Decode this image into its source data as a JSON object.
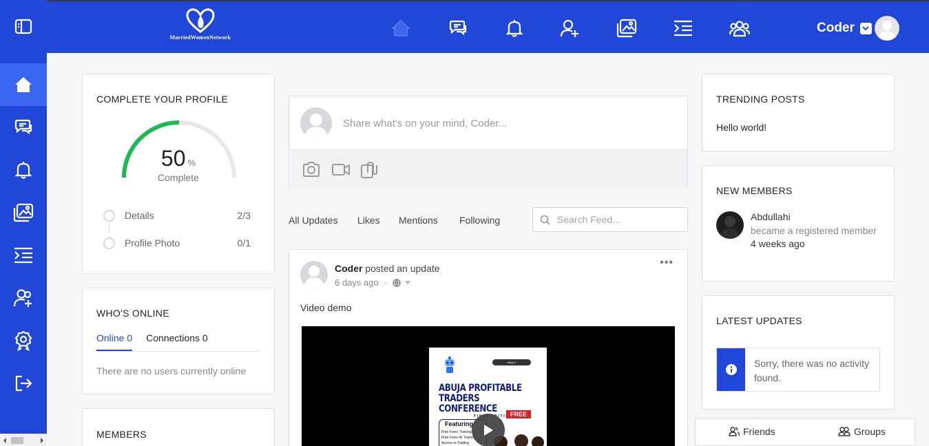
{
  "brand": {
    "logo_text": "MarriedWomenNetwork"
  },
  "header": {
    "nav_icons": [
      "home-icon",
      "messages-icon",
      "notifications-icon",
      "add-friend-icon",
      "photos-icon",
      "activity-icon",
      "groups-icon"
    ],
    "user_name": "Coder"
  },
  "sidebar": {
    "items": [
      "home-icon",
      "messages-icon",
      "notifications-icon",
      "photos-icon",
      "activity-icon",
      "friends-icon",
      "badges-icon",
      "logout-icon"
    ],
    "active_index": 0
  },
  "profile_complete": {
    "title": "COMPLETE YOUR PROFILE",
    "percent": "50",
    "percent_unit": "%",
    "complete_label": "Complete",
    "progress_fraction": 0.5,
    "progress_color": "#1db954",
    "steps": [
      {
        "label": "Details",
        "count": "2/3"
      },
      {
        "label": "Profile Photo",
        "count": "0/1"
      }
    ]
  },
  "whos_online": {
    "title": "WHO'S ONLINE",
    "tab_online": "Online 0",
    "tab_connections": "Connections 0",
    "empty_text": "There are no users currently online"
  },
  "members": {
    "title": "MEMBERS"
  },
  "composer": {
    "placeholder": "Share what's on your mind, Coder..."
  },
  "feed_tabs": [
    "All Updates",
    "Likes",
    "Mentions",
    "Following"
  ],
  "search_feed": {
    "placeholder": "Search Feed..."
  },
  "post": {
    "author": "Coder",
    "action": " posted an update",
    "time": "6 days ago",
    "separator": "·",
    "text": "Video demo",
    "poster": {
      "title_line1": "ABUJA PROFITABLE",
      "title_line2": "TRADERS CONFERENCE",
      "edition": "FIRST EDITION",
      "free": "FREE",
      "featuring": "Featuring:",
      "bullets": [
        "Free Forex Training",
        "Free Forex AI Training",
        "Access to Trading"
      ]
    }
  },
  "trending": {
    "title": "TRENDING POSTS",
    "item": "Hello world!"
  },
  "new_members": {
    "title": "NEW MEMBERS",
    "name": "Abdullahi",
    "action": "became a registered member",
    "time": "4 weeks ago"
  },
  "latest_updates": {
    "title": "LATEST UPDATES",
    "notice": "Sorry, there was no activity found."
  },
  "bottom_bar": {
    "friends": "Friends",
    "groups": "Groups"
  },
  "colors": {
    "brand_blue": "#2047d8",
    "active_blue": "#3b66f0"
  }
}
